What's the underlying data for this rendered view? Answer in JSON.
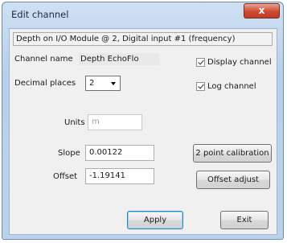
{
  "window": {
    "title": "Edit channel",
    "close_glyph": "x"
  },
  "channel_header": "Depth on I/O Module @ 2, Digital input #1 (frequency)",
  "channel_name": {
    "label": "Channel name",
    "value": "Depth EchoFlo"
  },
  "decimal_places": {
    "label": "Decimal places",
    "value": "2"
  },
  "checkboxes": {
    "display_channel": {
      "label": "Display channel",
      "checked": true
    },
    "log_channel": {
      "label": "Log channel",
      "checked": true
    }
  },
  "units": {
    "label": "Units",
    "value": "m"
  },
  "slope": {
    "label": "Slope",
    "value": "0.00122"
  },
  "offset": {
    "label": "Offset",
    "value": "-1.19141"
  },
  "buttons": {
    "calibration": "2 point calibration",
    "offset_adjust": "Offset adjust",
    "apply": "Apply",
    "exit": "Exit"
  }
}
